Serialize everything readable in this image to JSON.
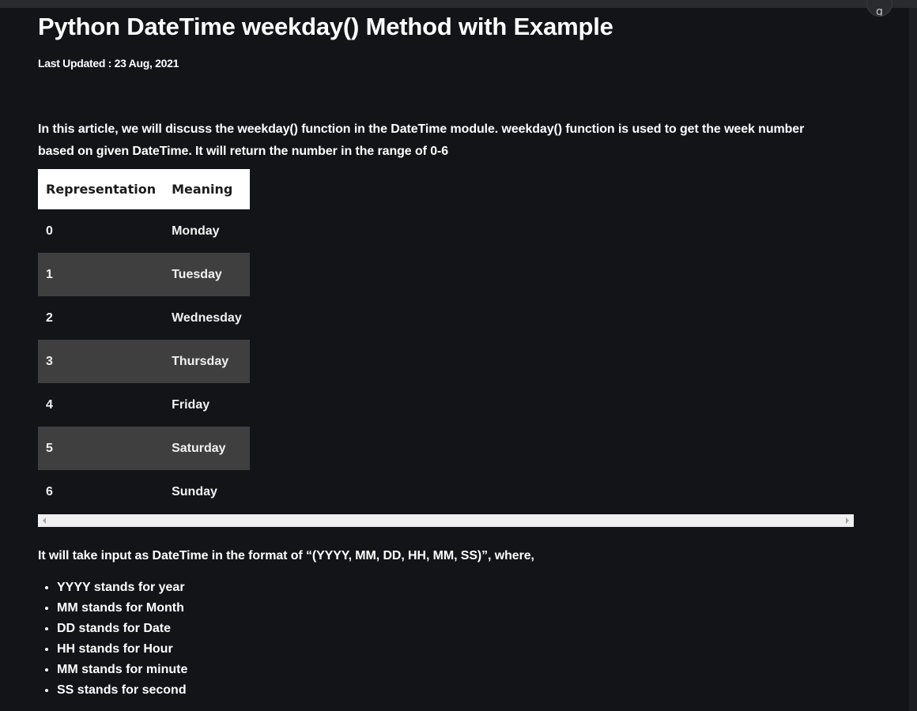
{
  "colors": {
    "background": "#131417",
    "text": "#ffffff",
    "table_header_bg": "#ffffff",
    "table_alt_row_bg": "#3f3f3f",
    "scrollbar_bg": "#f0f0f0"
  },
  "article": {
    "title": "Python DateTime weekday() Method with Example",
    "last_updated": "Last Updated : 23 Aug, 2021",
    "intro": "In this article, we will discuss the weekday() function in the DateTime module. weekday() function is used to get the week number based on given DateTime. It will return the number in the range of 0-6",
    "table": {
      "headers": [
        "Representation",
        "Meaning"
      ],
      "rows": [
        [
          "0",
          "Monday"
        ],
        [
          "1",
          "Tuesday"
        ],
        [
          "2",
          "Wednesday"
        ],
        [
          "3",
          "Thursday"
        ],
        [
          "4",
          "Friday"
        ],
        [
          "5",
          "Saturday"
        ],
        [
          "6",
          "Sunday"
        ]
      ]
    },
    "format_text": "It will take input as DateTime in the format of “(YYYY, MM, DD, HH, MM, SS)”, where,",
    "list_items": [
      "YYYY stands for year",
      "MM stands for Month",
      "DD stands for Date",
      "HH stands for Hour",
      "MM stands for minute",
      "SS stands for second"
    ]
  },
  "corner_button": {
    "icon": "partially-hidden-round-button-icon",
    "label": "g"
  }
}
